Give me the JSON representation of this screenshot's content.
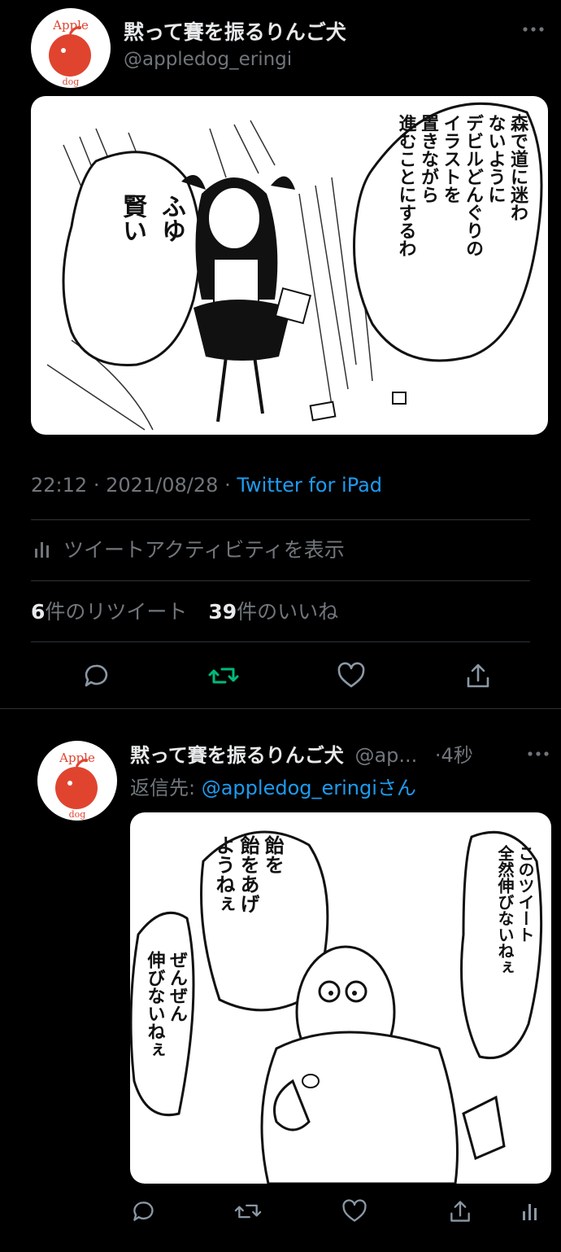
{
  "main_tweet": {
    "display_name": "黙って賽を振るりんご犬",
    "handle": "@appledog_eringi",
    "more_icon": "more-horizontal-icon",
    "image_text": {
      "bubble_right": [
        "森で道に迷わ",
        "ないように",
        "デビルどんぐりの",
        "イラストを",
        "置きながら",
        "進むことにするわ"
      ],
      "bubble_left": [
        "ふゆ",
        "賢い"
      ]
    },
    "time": "22:12",
    "date": "2021/08/28",
    "separator": "·",
    "source": "Twitter for iPad",
    "activity_label": "ツイートアクティビティを表示",
    "retweet_count": "6",
    "retweet_label": "件のリツイート",
    "like_count": "39",
    "like_label": "件のいいね"
  },
  "reply_tweet": {
    "display_name": "黙って賽を振るりんご犬",
    "handle": "@ap...",
    "time": "·4秒",
    "reply_prefix": "返信先: ",
    "reply_handle": "@appledog_eringi",
    "reply_suffix": "さん",
    "image_text": {
      "bubble_right": [
        "このツイート",
        "全然伸びないねぇ"
      ],
      "bubble_mid": [
        "飴を",
        "飴をあげ",
        "ようねぇ"
      ],
      "bubble_left": [
        "ぜんぜん",
        "伸びないねぇ"
      ]
    }
  },
  "avatar_text": {
    "top": "Apple",
    "bottom": "dog"
  },
  "colors": {
    "retweet_active": "#00ba7c",
    "link": "#1d9bf0",
    "muted": "#71767b",
    "divider": "#2f3336"
  }
}
